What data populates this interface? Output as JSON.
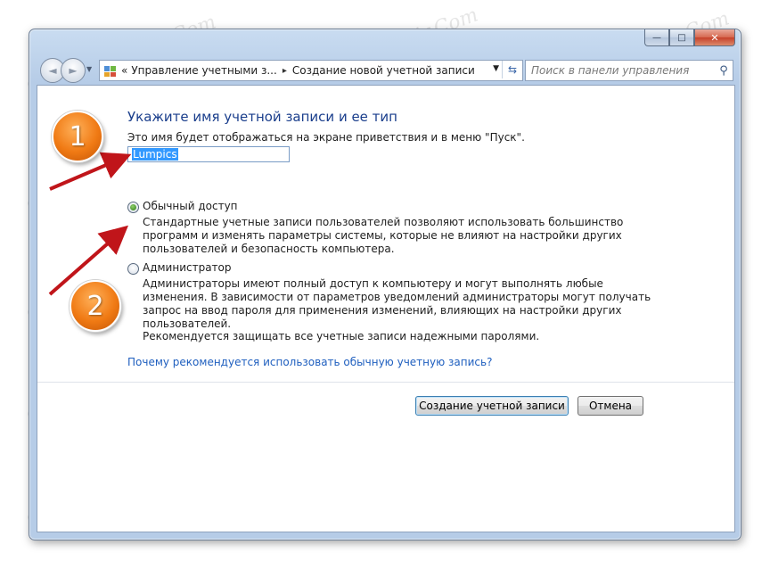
{
  "window": {
    "caption_buttons": {
      "minimize": "—",
      "maximize": "□",
      "close": "✕"
    }
  },
  "navigation": {
    "back_glyph": "◄",
    "forward_glyph": "►",
    "breadcrumb": [
      "Управление учетными з...",
      "Создание новой учетной записи"
    ],
    "breadcrumb_prefix": "«",
    "separator": "▸",
    "search_placeholder": "Поиск в панели управления"
  },
  "form": {
    "title": "Укажите имя учетной записи и ее тип",
    "hint": "Это имя будет отображаться на экране приветствия и в меню \"Пуск\".",
    "account_name": "Lumpics",
    "options": [
      {
        "label": "Обычный доступ",
        "selected": true,
        "description": "Стандартные учетные записи пользователей позволяют использовать большинство программ и изменять параметры системы, которые не влияют на настройки других пользователей и безопасность компьютера."
      },
      {
        "label": "Администратор",
        "selected": false,
        "description": "Администраторы имеют полный доступ к компьютеру и могут выполнять любые изменения. В зависимости от параметров уведомлений администраторы могут получать запрос на ввод пароля для применения изменений, влияющих на настройки других пользователей."
      }
    ],
    "recommendation": "Рекомендуется защищать все учетные записи надежными паролями.",
    "help_link": "Почему рекомендуется использовать обычную учетную запись?",
    "create_button": "Создание учетной записи",
    "cancel_button": "Отмена"
  },
  "annotations": {
    "badge_1": "1",
    "badge_2": "2",
    "arrow_color": "#c0151a",
    "badge_color": "#f07a14"
  },
  "watermark": "Soringpcrepair.Com"
}
